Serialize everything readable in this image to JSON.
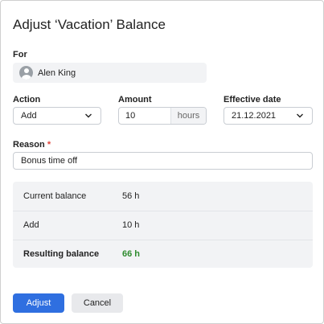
{
  "dialog": {
    "title": "Adjust ‘Vacation’ Balance"
  },
  "for": {
    "label": "For",
    "user_name": "Alen King"
  },
  "action": {
    "label": "Action",
    "value": "Add"
  },
  "amount": {
    "label": "Amount",
    "value": "10",
    "unit": "hours"
  },
  "effective_date": {
    "label": "Effective date",
    "value": "21.12.2021"
  },
  "reason": {
    "label": "Reason",
    "required_marker": "*",
    "value": "Bonus time off"
  },
  "summary": {
    "current_label": "Current balance",
    "current_value": "56 h",
    "add_label": "Add",
    "add_value": "10 h",
    "resulting_label": "Resulting balance",
    "resulting_value": "66 h",
    "resulting_color": "#2e8b2e"
  },
  "buttons": {
    "adjust": "Adjust",
    "cancel": "Cancel"
  },
  "colors": {
    "primary": "#2f6fe0",
    "required": "#e0443a"
  }
}
